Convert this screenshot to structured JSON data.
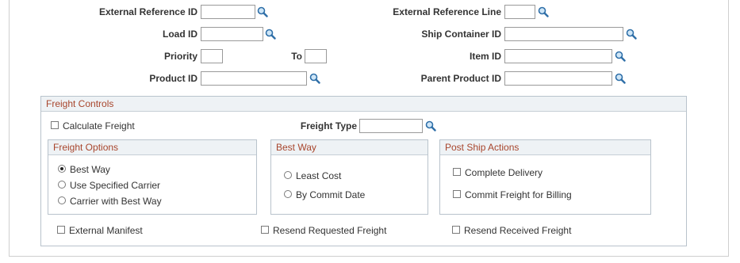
{
  "search": {
    "external_reference_id": "External Reference ID",
    "external_reference_line": "External Reference Line",
    "load_id": "Load ID",
    "ship_container_id": "Ship Container ID",
    "priority": "Priority",
    "to": "To",
    "item_id": "Item ID",
    "product_id": "Product ID",
    "parent_product_id": "Parent Product ID"
  },
  "freight_controls": {
    "title": "Freight Controls",
    "calculate_freight": "Calculate Freight",
    "freight_type": "Freight Type",
    "freight_options": {
      "title": "Freight Options",
      "items": [
        "Best Way",
        "Use Specified Carrier",
        "Carrier with Best Way"
      ],
      "selected": "Best Way"
    },
    "best_way": {
      "title": "Best Way",
      "items": [
        "Least Cost",
        "By Commit Date"
      ]
    },
    "post_ship": {
      "title": "Post Ship Actions",
      "items": [
        "Complete Delivery",
        "Commit Freight for Billing"
      ]
    },
    "external_manifest": "External Manifest",
    "resend_requested_freight": "Resend Requested Freight",
    "resend_received_freight": "Resend Received Freight"
  }
}
